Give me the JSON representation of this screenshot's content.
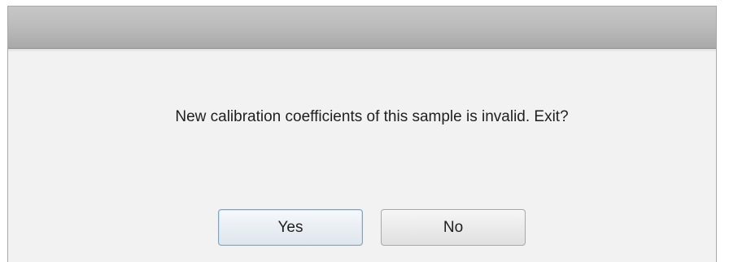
{
  "dialog": {
    "title": "",
    "message": "New calibration coefficients of this sample is invalid. Exit?",
    "buttons": {
      "yes_label": "Yes",
      "no_label": "No"
    }
  },
  "colors": {
    "titlebar": "#b9b9b9",
    "body": "#f2f2f2",
    "default_button_border": "#7ea4c4"
  }
}
